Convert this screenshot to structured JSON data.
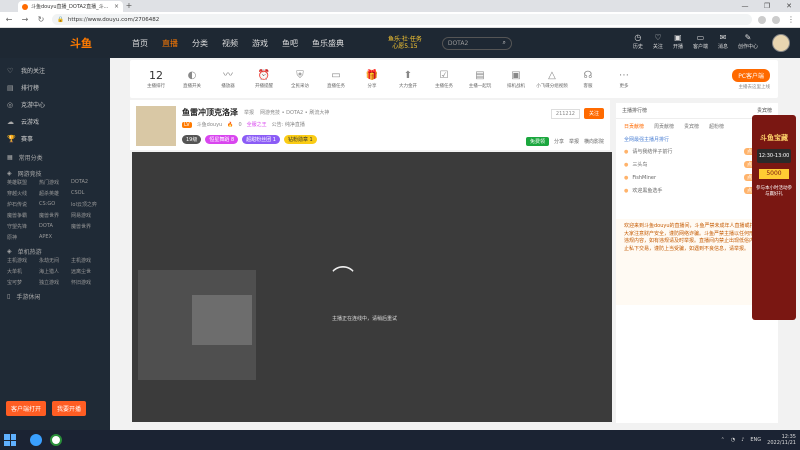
{
  "browser": {
    "tab_title": "斗鱼douyu直播_DOTA2直播_斗...",
    "url": "https://www.douyu.com/2706482",
    "window_controls": [
      "—",
      "❐",
      "✕"
    ]
  },
  "header": {
    "logo": "斗鱼",
    "nav": [
      "首页",
      "直播",
      "分类",
      "视频",
      "游戏",
      "鱼吧",
      "鱼乐盛典"
    ],
    "promo_line1": "鱼乐·社·任务",
    "promo_line2": "心愿5.15",
    "search_placeholder": "DOTA2",
    "icons": [
      {
        "label": "历史",
        "icon": "clock-icon"
      },
      {
        "label": "关注",
        "icon": "heart-icon"
      },
      {
        "label": "开播",
        "icon": "broadcast-icon"
      },
      {
        "label": "客户端",
        "icon": "client-icon"
      },
      {
        "label": "消息",
        "icon": "message-icon"
      },
      {
        "label": "创作中心",
        "icon": "creator-icon"
      }
    ]
  },
  "sidebar": {
    "items": [
      {
        "label": "我的关注",
        "icon": "♡"
      },
      {
        "label": "排行榜",
        "icon": "▤"
      },
      {
        "label": "克游中心",
        "icon": "◎"
      },
      {
        "label": "云游戏",
        "icon": "☁"
      },
      {
        "label": "赛事",
        "icon": "🏆"
      }
    ],
    "common_title": "常用分类",
    "online_title": "网游竞技",
    "online_games": [
      "英雄联盟",
      "热门游戏",
      "DOTA2",
      "穿越火线",
      "超杀英雄",
      "CSOL",
      "炉石传说",
      "CS:GO",
      "lol云顶之弈",
      "魔兽争霸",
      "魔兽世界",
      "网易游戏",
      "守望先锋",
      "DOTA",
      "魔兽世界",
      "原神",
      "APEX"
    ],
    "single_title": "单机热游",
    "single_games": [
      "主机游戏",
      "永劫无间",
      "主机游戏",
      "大单机",
      "海上猎人",
      "远离尘世",
      "宝可梦",
      "独立游戏",
      "怀旧游戏"
    ],
    "mobile_title": "手游休闲",
    "btn_rank": "客户端打开",
    "btn_live": "我要开播"
  },
  "toolbar": {
    "count": "12",
    "count_label": "主播排行",
    "items": [
      {
        "label": "直播开关",
        "icon": "toggle-icon",
        "badge": "1"
      },
      {
        "label": "播放器",
        "icon": "wave-icon"
      },
      {
        "label": "开播提醒",
        "icon": "alarm-icon"
      },
      {
        "label": "全民采访",
        "icon": "shield-icon"
      },
      {
        "label": "直播任务",
        "icon": "tv-icon"
      },
      {
        "label": "分享",
        "icon": "gift-icon"
      },
      {
        "label": "大力金开",
        "icon": "rocket-icon",
        "badge": "NEW"
      },
      {
        "label": "主播任务",
        "icon": "check-icon"
      },
      {
        "label": "主播一起玩",
        "icon": "clipboard-icon"
      },
      {
        "label": "排机战机",
        "icon": "monitor-icon"
      },
      {
        "label": "小飞碟分组视频",
        "icon": "ufo-icon"
      },
      {
        "label": "客服",
        "icon": "headset-icon"
      },
      {
        "label": "更多",
        "icon": "more-icon"
      }
    ],
    "pc_button": "PC客户端",
    "pc_sub": "主播去这里上线"
  },
  "room": {
    "title": "鱼雷冲顶克洛泽",
    "tag": "举报",
    "category_path": "网游竞技 • DOTA2 • 刷流大神",
    "streamer": "斗鱼douyu",
    "level": "LV",
    "fans": "0",
    "notice": "全服之王",
    "followers_label": "公告: 纯净直播",
    "room_id": "211212",
    "follow": "关注",
    "tags": [
      {
        "text": "19级",
        "bg": "#555",
        "fg": "#fff"
      },
      {
        "text": "恒星舞蹈 8",
        "bg": "#d946ef",
        "fg": "#fff"
      },
      {
        "text": "超甜粉丝团 1",
        "bg": "#8b5cf6",
        "fg": "#fff"
      },
      {
        "text": "钻粉勋章 1",
        "bg": "#facc15",
        "fg": "#333"
      }
    ],
    "free_gift": "免费领",
    "share": "分享",
    "report": "举报",
    "more": "横向影院"
  },
  "video": {
    "status": "主播正在连线中，请稍后重试"
  },
  "rpanel": {
    "tabs": [
      "主播排行榜",
      "贵宾榜"
    ],
    "subtabs": [
      "日贡献榜",
      "周贡献榜",
      "贵宾榜",
      "超粉榜"
    ],
    "note": "全网最强主播月排行",
    "list": [
      {
        "name": "请与我结伴子前行",
        "badge": "点亮本场"
      },
      {
        "name": "三头鸟",
        "badge": "点亮本场"
      },
      {
        "name": "FishMiner",
        "badge": "点亮本场"
      },
      {
        "name": "欢迎黑鱼选手",
        "badge": "点亮本场"
      }
    ],
    "chat": "欢迎来到斗鱼douyu的直播间，斗鱼严禁未成年人直播或打赏，请大家注意财产安全，谨防网络诈骗。斗鱼严禁主播以任何形式发布违规内容，如有违规请及时举报。直播间内禁止出现低俗内容，禁止私下交易，谨防上当受骗，如遇到不良信息，请举报。"
  },
  "ad": {
    "title": "斗鱼宝藏",
    "time": "12:30-13:00",
    "amount": "5000",
    "desc": "参与本小时活动参与赢好礼"
  },
  "taskbar": {
    "time": "12:35",
    "date": "2022/11/21",
    "lang": "ENG"
  }
}
